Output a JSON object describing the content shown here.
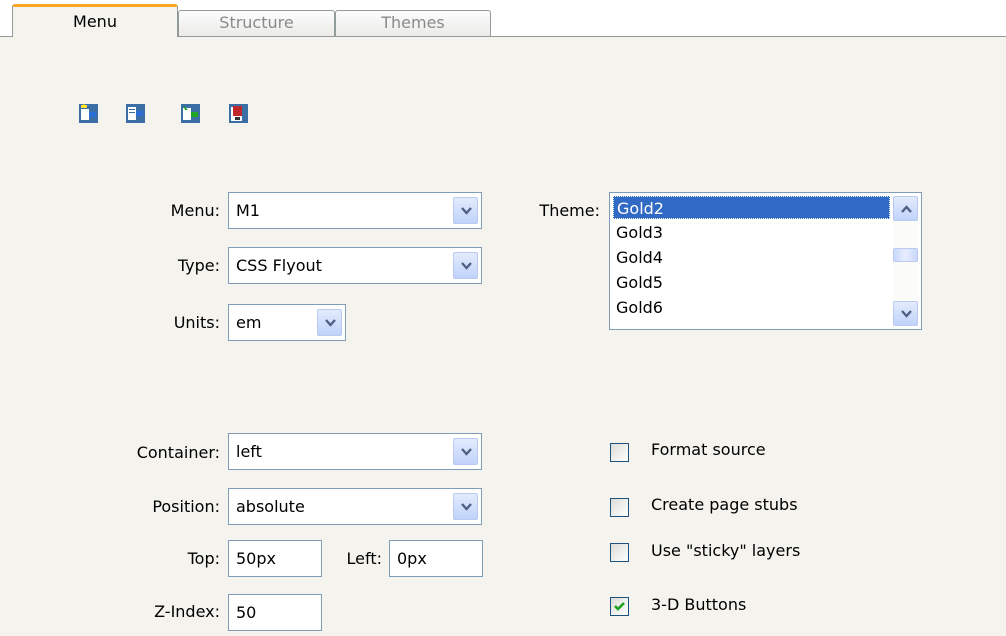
{
  "tabs": [
    {
      "label": "Menu",
      "active": true
    },
    {
      "label": "Structure",
      "active": false
    },
    {
      "label": "Themes",
      "active": false
    }
  ],
  "toolbar": [
    {
      "icon": "add-menu-icon"
    },
    {
      "icon": "add-item-icon"
    },
    {
      "icon": "add-subitem-icon"
    },
    {
      "icon": "delete-item-icon"
    }
  ],
  "fields": {
    "menu": {
      "label": "Menu:",
      "value": "M1"
    },
    "type": {
      "label": "Type:",
      "value": "CSS Flyout"
    },
    "units": {
      "label": "Units:",
      "value": "em"
    },
    "container": {
      "label": "Container:",
      "value": "left"
    },
    "position": {
      "label": "Position:",
      "value": "absolute"
    },
    "top": {
      "label": "Top:",
      "value": "50px"
    },
    "left": {
      "label": "Left:",
      "value": "0px"
    },
    "zindex": {
      "label": "Z-Index:",
      "value": "50"
    }
  },
  "theme": {
    "label": "Theme:",
    "items": [
      "Gold2",
      "Gold3",
      "Gold4",
      "Gold5",
      "Gold6"
    ],
    "selected": "Gold2"
  },
  "options": [
    {
      "label": "Format source",
      "checked": false
    },
    {
      "label": "Create page stubs",
      "checked": false
    },
    {
      "label": "Use \"sticky\" layers",
      "checked": false
    },
    {
      "label": "3-D Buttons",
      "checked": true
    }
  ],
  "colors": {
    "accent": "#f5a623",
    "selection": "#316ac5",
    "panel": "#f4f3ee",
    "check": "#21a121"
  }
}
